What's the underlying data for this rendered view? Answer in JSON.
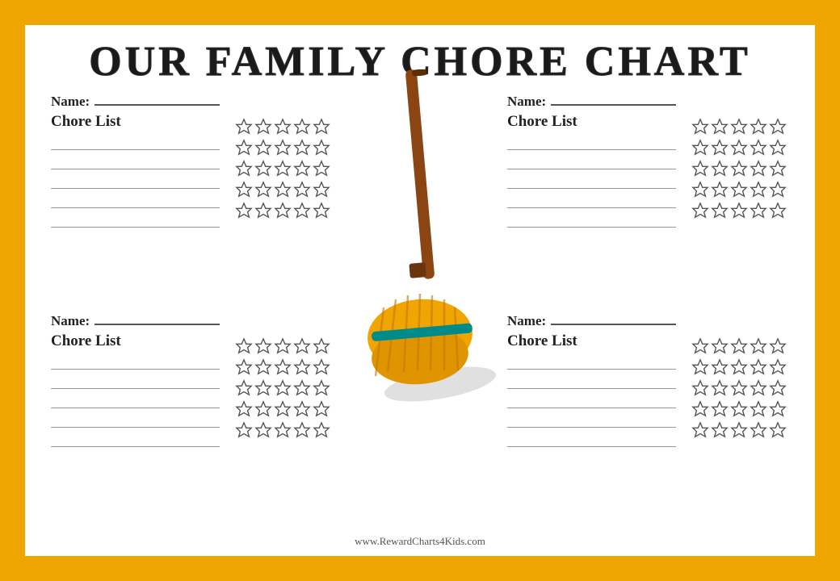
{
  "page": {
    "title": "OUR FAMILY CHORE CHART",
    "website": "www.RewardCharts4Kids.com",
    "name_label": "Name:",
    "chore_list_label": "Chore List",
    "quadrants": [
      {
        "id": "top-left",
        "position": "top-left"
      },
      {
        "id": "top-right",
        "position": "top-right"
      },
      {
        "id": "bottom-left",
        "position": "bottom-left"
      },
      {
        "id": "bottom-right",
        "position": "bottom-right"
      }
    ],
    "stars_per_row": 5,
    "star_rows": 5,
    "chore_lines": 5
  }
}
